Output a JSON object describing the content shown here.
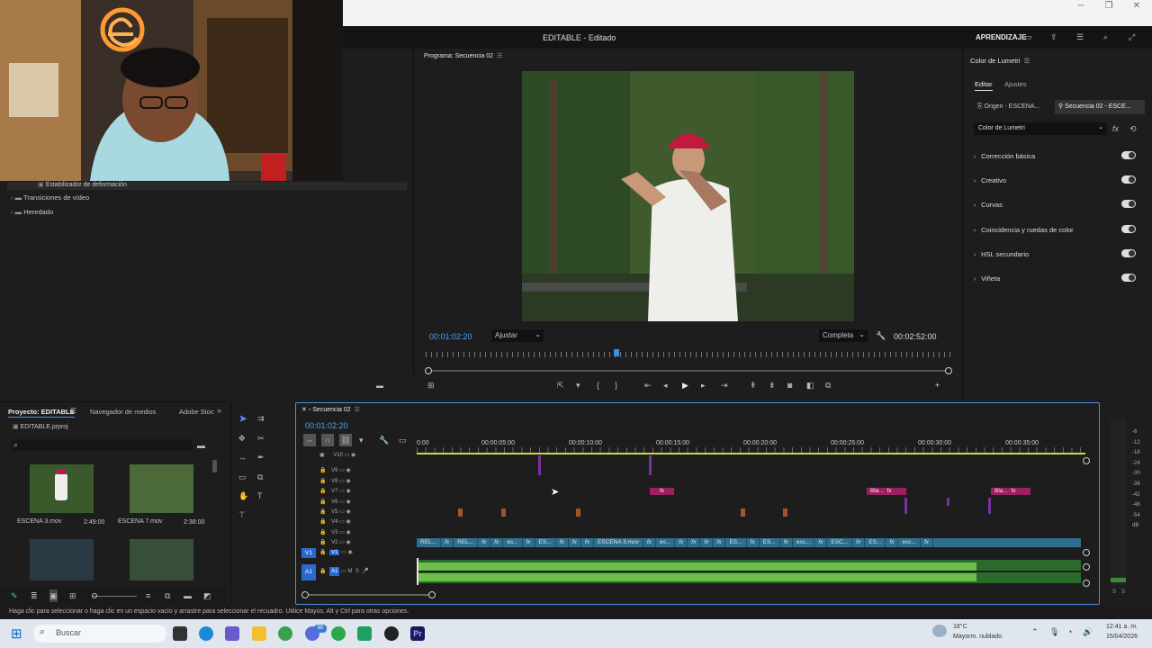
{
  "window": {
    "title": "EDITABLE",
    "status": "Editado",
    "workspace": "APRENDIZAJE"
  },
  "effects": {
    "items": [
      "Estabilizador de deformación",
      "Transiciones de vídeo",
      "Heredado"
    ]
  },
  "program": {
    "title": "Programa: Secuencia 02",
    "timecode": "00:01:02:20",
    "fit": "Ajustar",
    "quality": "Completa",
    "duration": "00:02:52:00"
  },
  "lumetri": {
    "title": "Color de Lumetri",
    "tabs": [
      "Editar",
      "Ajustes"
    ],
    "source": "Origen - ESCENA...",
    "sequence": "Secuencia 02 - ESCE...",
    "effect_select": "Color de Lumetri",
    "sections": [
      "Corrección básica",
      "Creativo",
      "Curvas",
      "Coincidencia y ruedas de color",
      "HSL secundario",
      "Viñeta"
    ]
  },
  "project": {
    "tabs": [
      "Proyecto: EDITABLE",
      "Navegador de medios",
      "Adobe Stoc"
    ],
    "file": "EDITABLE.prproj",
    "items": [
      {
        "name": "ESCENA 3.mov",
        "duration": "2:49:00"
      },
      {
        "name": "ESCENA 7.mov",
        "duration": "2:38:00"
      }
    ]
  },
  "timeline": {
    "title": "Secuencia 02",
    "timecode": "00:01:02:20",
    "ruler": [
      "0:00",
      "00:00:05:00",
      "00:00:10:00",
      "00:00:15:00",
      "00:00:20:00",
      "00:00:25:00",
      "00:00:30:00",
      "00:00:35:00"
    ],
    "video_tracks": [
      "V10",
      "V9",
      "V8",
      "V7",
      "V6",
      "V5",
      "V4",
      "V3",
      "V2",
      "V1"
    ],
    "audio_tracks": [
      "A1"
    ],
    "track_labels": {
      "v1": "V1",
      "a1": "A1",
      "mute": "M",
      "solo": "S"
    },
    "v1_clips": [
      "REL...",
      "fx",
      "REL...",
      "fx",
      "fx",
      "es...",
      "fx",
      "ES...",
      "fx",
      "fx",
      "fx",
      "ESCENA 3.mov",
      "fx",
      "es...",
      "fx",
      "fx",
      "fx",
      "fx",
      "ES...",
      "fx",
      "ES...",
      "fx",
      "esc...",
      "fx",
      "ESC...",
      "fx",
      "ES...",
      "fx",
      "esc...",
      "fx"
    ],
    "pink_clips": [
      {
        "label": "fx"
      },
      {
        "label": "Bla...",
        "fx": "fx"
      },
      {
        "label": "Bla...",
        "fx": "fx"
      }
    ],
    "meter": [
      "-6",
      "-12",
      "-18",
      "-24",
      "-30",
      "-36",
      "-42",
      "-48",
      "-54",
      "dB"
    ],
    "meter_footer": [
      "S",
      "S"
    ]
  },
  "statusbar": {
    "text": "Haga clic para seleccionar o haga clic en un espacio vacío y arrastre para seleccionar el recuadro. Utilice Mayús, Alt y Ctrl para otras opciones."
  },
  "taskbar": {
    "search": "Buscar",
    "weather_temp": "18°C",
    "weather_desc": "Mayorm. nublado",
    "time": "12:41 a. m.",
    "date": "15/04/2026",
    "badge": "80"
  }
}
